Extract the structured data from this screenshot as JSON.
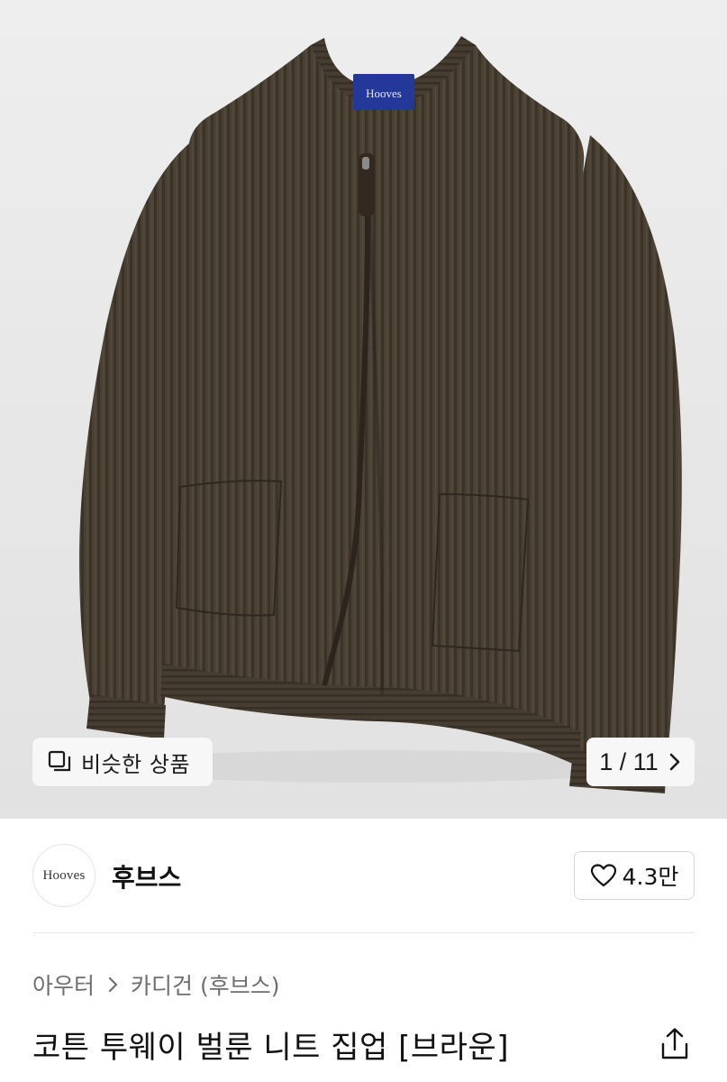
{
  "gallery": {
    "similar_label": "비슷한 상품",
    "counter_text": "1 / 11",
    "garment_tag_text": "Hooves"
  },
  "brand": {
    "logo_text": "Hooves",
    "name": "후브스",
    "like_count": "4.3만"
  },
  "breadcrumb": {
    "items": [
      "아우터",
      "카디건 (후브스)"
    ]
  },
  "product": {
    "title": "코튼 투웨이 벌룬 니트 집업 [브라운]"
  },
  "colors": {
    "garment": "#4a4034",
    "background": "#e9e9e9",
    "tag": "#24389a"
  }
}
